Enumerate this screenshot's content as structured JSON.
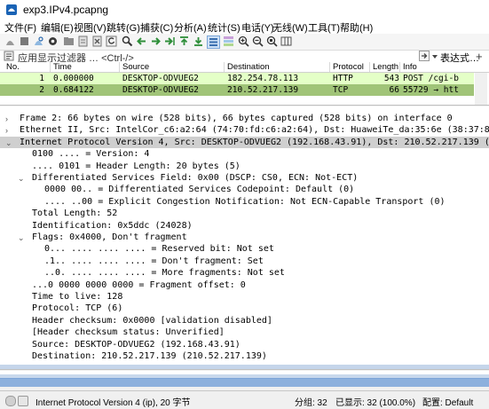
{
  "window": {
    "title": "exp3.IPv4.pcapng"
  },
  "menu": [
    "文件(F)",
    "编辑(E)",
    "视图(V)",
    "跳转(G)",
    "捕获(C)",
    "分析(A)",
    "统计(S)",
    "电话(Y)",
    "无线(W)",
    "工具(T)",
    "帮助(H)"
  ],
  "filter": {
    "placeholder": "应用显示过滤器 … <Ctrl-/>",
    "expression_label": "表达式…",
    "add_label": "+"
  },
  "packet_list": {
    "columns": [
      "No.",
      "Time",
      "Source",
      "Destination",
      "Protocol",
      "Length",
      "Info"
    ],
    "rows": [
      {
        "no": "1",
        "time": "0.000000",
        "source": "DESKTOP-ODVUEG2",
        "destination": "182.254.78.113",
        "protocol": "HTTP",
        "length": "543",
        "info": "POST /cgi-b",
        "color": "#e4ffc7"
      },
      {
        "no": "2",
        "time": "0.684122",
        "source": "DESKTOP-ODVUEG2",
        "destination": "210.52.217.139",
        "protocol": "TCP",
        "length": "66",
        "info": "55729 → htt",
        "color": "#a0c478"
      }
    ]
  },
  "details": [
    {
      "tri": "›",
      "indent": 0,
      "text": "Frame 2: 66 bytes on wire (528 bits), 66 bytes captured (528 bits) on interface 0"
    },
    {
      "tri": "›",
      "indent": 0,
      "text": "Ethernet II, Src: IntelCor_c6:a2:64 (74:70:fd:c6:a2:64), Dst: HuaweiTe_da:35:6e (38:37:8b:d"
    },
    {
      "tri": "⌄",
      "indent": 0,
      "text": "Internet Protocol Version 4, Src: DESKTOP-ODVUEG2 (192.168.43.91), Dst: 210.52.217.139 (210"
    },
    {
      "tri": "",
      "indent": 1,
      "text": "0100 .... = Version: 4"
    },
    {
      "tri": "",
      "indent": 1,
      "text": ".... 0101 = Header Length: 20 bytes (5)"
    },
    {
      "tri": "⌄",
      "indent": 1,
      "text": "Differentiated Services Field: 0x00 (DSCP: CS0, ECN: Not-ECT)"
    },
    {
      "tri": "",
      "indent": 2,
      "text": "0000 00.. = Differentiated Services Codepoint: Default (0)"
    },
    {
      "tri": "",
      "indent": 2,
      "text": ".... ..00 = Explicit Congestion Notification: Not ECN-Capable Transport (0)"
    },
    {
      "tri": "",
      "indent": 1,
      "text": "Total Length: 52"
    },
    {
      "tri": "",
      "indent": 1,
      "text": "Identification: 0x5ddc (24028)"
    },
    {
      "tri": "⌄",
      "indent": 1,
      "text": "Flags: 0x4000, Don't fragment"
    },
    {
      "tri": "",
      "indent": 2,
      "text": "0... .... .... .... = Reserved bit: Not set"
    },
    {
      "tri": "",
      "indent": 2,
      "text": ".1.. .... .... .... = Don't fragment: Set"
    },
    {
      "tri": "",
      "indent": 2,
      "text": "..0. .... .... .... = More fragments: Not set"
    },
    {
      "tri": "",
      "indent": 1,
      "text": "...0 0000 0000 0000 = Fragment offset: 0"
    },
    {
      "tri": "",
      "indent": 1,
      "text": "Time to live: 128"
    },
    {
      "tri": "",
      "indent": 1,
      "text": "Protocol: TCP (6)"
    },
    {
      "tri": "",
      "indent": 1,
      "text": "Header checksum: 0x0000 [validation disabled]"
    },
    {
      "tri": "",
      "indent": 1,
      "text": "[Header checksum status: Unverified]"
    },
    {
      "tri": "",
      "indent": 1,
      "text": "Source: DESKTOP-ODVUEG2 (192.168.43.91)"
    },
    {
      "tri": "",
      "indent": 1,
      "text": "Destination: 210.52.217.139 (210.52.217.139)"
    }
  ],
  "status": {
    "left": "Internet Protocol Version 4 (ip), 20 字节",
    "packets": "分组: 32",
    "displayed": "已显示: 32 (100.0%)",
    "profile": "配置: Default"
  },
  "colors": {
    "selection": "#cfcfcf",
    "row_http": "#e4ffc7",
    "row_tcp": "#a0c478",
    "accent_blue": "#5b8fcf"
  },
  "icons": {
    "toolbar": [
      "shark-fin-start-icon",
      "stop-square-icon",
      "restart-shark-icon",
      "gear-options-icon",
      "open-folder-icon",
      "save-file-icon",
      "close-file-icon",
      "reload-icon",
      "find-packet-icon",
      "back-arrow-icon",
      "forward-arrow-icon",
      "go-to-packet-icon",
      "first-packet-icon",
      "last-packet-icon",
      "autoscroll-icon",
      "colorize-icon",
      "zoom-in-icon",
      "zoom-out-icon",
      "zoom-reset-icon",
      "resize-columns-icon"
    ]
  }
}
